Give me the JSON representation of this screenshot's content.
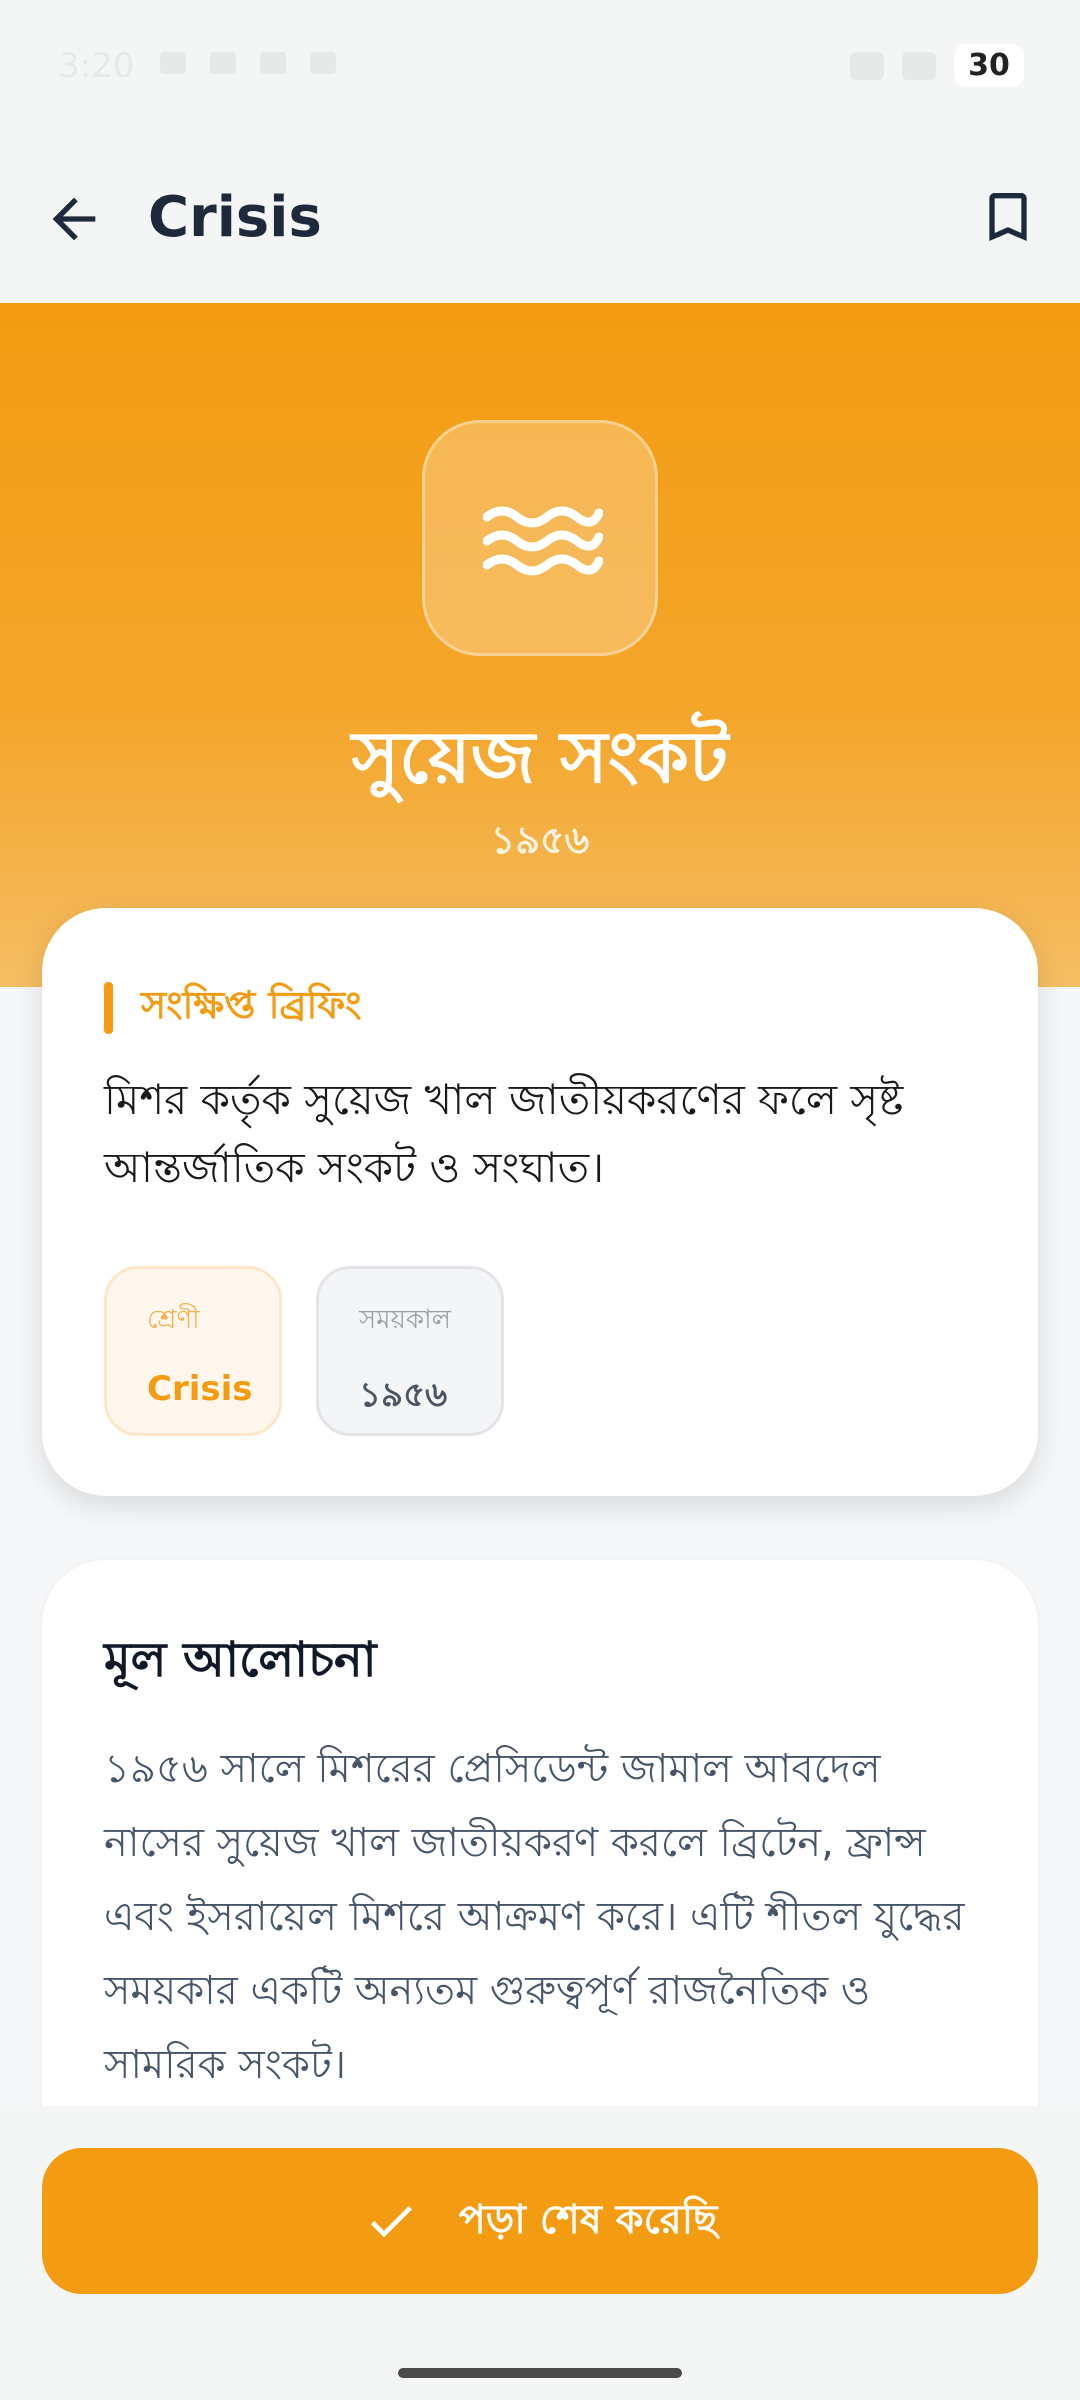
{
  "status_bar": {
    "time": "3:20",
    "battery": "30"
  },
  "app_bar": {
    "title": "Crisis",
    "back_icon": "arrow-left-icon",
    "bookmark_icon": "bookmark-icon"
  },
  "hero": {
    "icon": "waves-icon",
    "title": "সুয়েজ সংকট",
    "year": "১৯৫৬",
    "color": "#f39c12"
  },
  "brief": {
    "label": "সংক্ষিপ্ত ব্রিফিং",
    "text": "মিশর কর্তৃক সুয়েজ খাল জাতীয়করণের ফলে সৃষ্ট আন্তর্জাতিক সংকট ও সংঘাত।",
    "category_label": "শ্রেণী",
    "category_value": "Crisis",
    "period_label": "সময়কাল",
    "period_value": "১৯৫৬"
  },
  "discussion": {
    "title": "মূল আলোচনা",
    "text": "১৯৫৬ সালে মিশরের প্রেসিডেন্ট জামাল আবদেল নাসের সুয়েজ খাল জাতীয়করণ করলে ব্রিটেন, ফ্রান্স এবং ইসরায়েল মিশরে আক্রমণ করে। এটি শীতল যুদ্ধের সময়কার একটি অন্যতম গুরুত্বপূর্ণ রাজনৈতিক ও সামরিক সংকট।"
  },
  "action": {
    "done_label": "পড়া শেষ করেছি",
    "done_icon": "check-icon"
  }
}
